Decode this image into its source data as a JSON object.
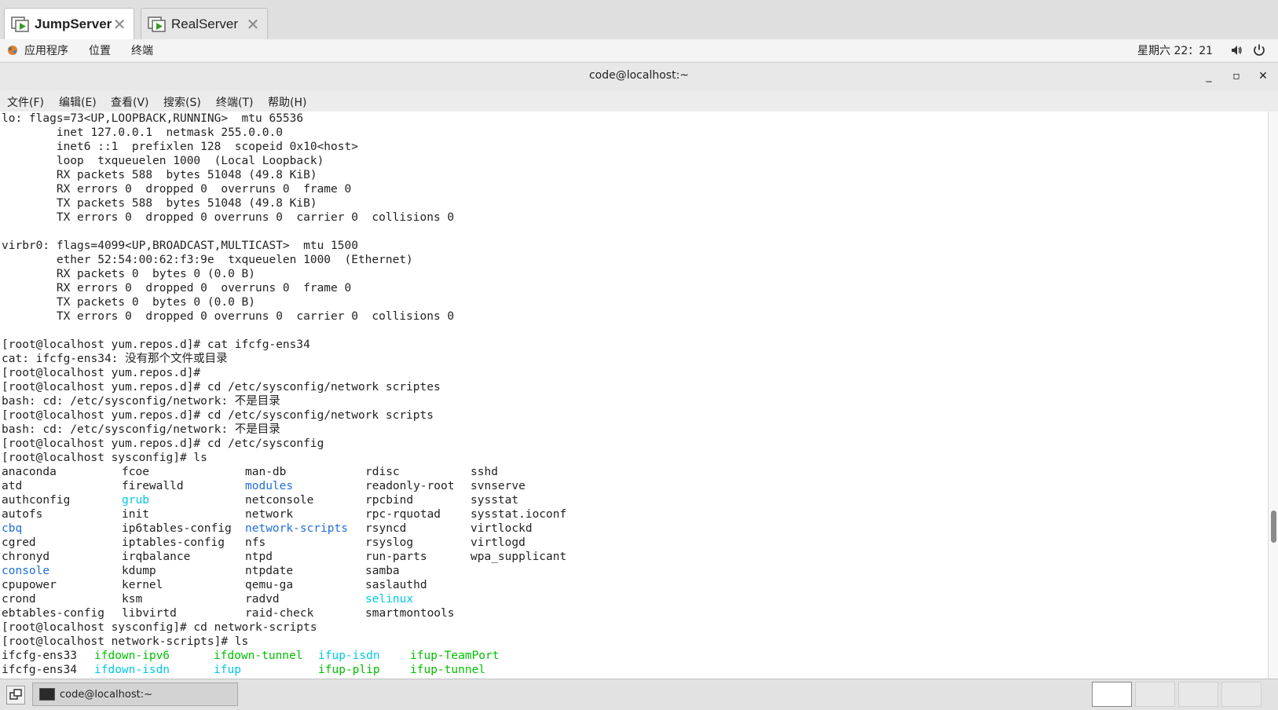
{
  "tabs": [
    {
      "label": "JumpServer",
      "active": true,
      "icon": "remote-screen-icon"
    },
    {
      "label": "RealServer",
      "active": false,
      "icon": "remote-screen-icon"
    }
  ],
  "gnome_bar": {
    "applications": "应用程序",
    "places": "位置",
    "terminal": "终端",
    "clock": "星期六 22：21",
    "volume_icon": "speaker-icon",
    "power_icon": "power-icon"
  },
  "window": {
    "title": "code@localhost:~",
    "minimize": "_",
    "maximize": "▫",
    "close": "✕"
  },
  "menu": [
    "文件(F)",
    "编辑(E)",
    "查看(V)",
    "搜索(S)",
    "终端(T)",
    "帮助(H)"
  ],
  "colors": {
    "terminal_bg": "#ffffff",
    "text": "#222222",
    "dir": "#1e6fd9",
    "link": "#00c8e6",
    "exec": "#00c000"
  },
  "terminal": {
    "lines": [
      [
        {
          "t": "lo: flags=73<UP,LOOPBACK,RUNNING>  mtu 65536"
        }
      ],
      [
        {
          "t": "        inet 127.0.0.1  netmask 255.0.0.0"
        }
      ],
      [
        {
          "t": "        inet6 ::1  prefixlen 128  scopeid 0x10<host>"
        }
      ],
      [
        {
          "t": "        loop  txqueuelen 1000  (Local Loopback)"
        }
      ],
      [
        {
          "t": "        RX packets 588  bytes 51048 (49.8 KiB)"
        }
      ],
      [
        {
          "t": "        RX errors 0  dropped 0  overruns 0  frame 0"
        }
      ],
      [
        {
          "t": "        TX packets 588  bytes 51048 (49.8 KiB)"
        }
      ],
      [
        {
          "t": "        TX errors 0  dropped 0 overruns 0  carrier 0  collisions 0"
        }
      ],
      [
        {
          "t": ""
        }
      ],
      [
        {
          "t": "virbr0: flags=4099<UP,BROADCAST,MULTICAST>  mtu 1500"
        }
      ],
      [
        {
          "t": "        ether 52:54:00:62:f3:9e  txqueuelen 1000  (Ethernet)"
        }
      ],
      [
        {
          "t": "        RX packets 0  bytes 0 (0.0 B)"
        }
      ],
      [
        {
          "t": "        RX errors 0  dropped 0  overruns 0  frame 0"
        }
      ],
      [
        {
          "t": "        TX packets 0  bytes 0 (0.0 B)"
        }
      ],
      [
        {
          "t": "        TX errors 0  dropped 0 overruns 0  carrier 0  collisions 0"
        }
      ],
      [
        {
          "t": ""
        }
      ],
      [
        {
          "t": "[root@localhost yum.repos.d]# cat ifcfg-ens34"
        }
      ],
      [
        {
          "t": "cat: ifcfg-ens34: 没有那个文件或目录"
        }
      ],
      [
        {
          "t": "[root@localhost yum.repos.d]#"
        }
      ],
      [
        {
          "t": "[root@localhost yum.repos.d]# cd /etc/sysconfig/network scriptes"
        }
      ],
      [
        {
          "t": "bash: cd: /etc/sysconfig/network: 不是目录"
        }
      ],
      [
        {
          "t": "[root@localhost yum.repos.d]# cd /etc/sysconfig/network scripts"
        }
      ],
      [
        {
          "t": "bash: cd: /etc/sysconfig/network: 不是目录"
        }
      ],
      [
        {
          "t": "[root@localhost yum.repos.d]# cd /etc/sysconfig"
        }
      ],
      [
        {
          "t": "[root@localhost sysconfig]# ls"
        }
      ],
      {
        "grid": [
          {
            "t": "anaconda"
          },
          {
            "t": "fcoe"
          },
          {
            "t": "man-db"
          },
          {
            "t": "rdisc"
          },
          {
            "t": "sshd"
          }
        ]
      },
      {
        "grid": [
          {
            "t": "atd"
          },
          {
            "t": "firewalld"
          },
          {
            "t": "modules",
            "c": "dir"
          },
          {
            "t": "readonly-root"
          },
          {
            "t": "svnserve"
          }
        ]
      },
      {
        "grid": [
          {
            "t": "authconfig"
          },
          {
            "t": "grub",
            "c": "link"
          },
          {
            "t": "netconsole"
          },
          {
            "t": "rpcbind"
          },
          {
            "t": "sysstat"
          }
        ]
      },
      {
        "grid": [
          {
            "t": "autofs"
          },
          {
            "t": "init"
          },
          {
            "t": "network"
          },
          {
            "t": "rpc-rquotad"
          },
          {
            "t": "sysstat.ioconf"
          }
        ]
      },
      {
        "grid": [
          {
            "t": "cbq",
            "c": "dir"
          },
          {
            "t": "ip6tables-config"
          },
          {
            "t": "network-scripts",
            "c": "dir"
          },
          {
            "t": "rsyncd"
          },
          {
            "t": "virtlockd"
          }
        ]
      },
      {
        "grid": [
          {
            "t": "cgred"
          },
          {
            "t": "iptables-config"
          },
          {
            "t": "nfs"
          },
          {
            "t": "rsyslog"
          },
          {
            "t": "virtlogd"
          }
        ]
      },
      {
        "grid": [
          {
            "t": "chronyd"
          },
          {
            "t": "irqbalance"
          },
          {
            "t": "ntpd"
          },
          {
            "t": "run-parts"
          },
          {
            "t": "wpa_supplicant"
          }
        ]
      },
      {
        "grid": [
          {
            "t": "console",
            "c": "dir"
          },
          {
            "t": "kdump"
          },
          {
            "t": "ntpdate"
          },
          {
            "t": "samba"
          },
          {
            "t": ""
          }
        ]
      },
      {
        "grid": [
          {
            "t": "cpupower"
          },
          {
            "t": "kernel"
          },
          {
            "t": "qemu-ga"
          },
          {
            "t": "saslauthd"
          },
          {
            "t": ""
          }
        ]
      },
      {
        "grid": [
          {
            "t": "crond"
          },
          {
            "t": "ksm"
          },
          {
            "t": "radvd"
          },
          {
            "t": "selinux",
            "c": "link"
          },
          {
            "t": ""
          }
        ]
      },
      {
        "grid": [
          {
            "t": "ebtables-config"
          },
          {
            "t": "libvirtd"
          },
          {
            "t": "raid-check"
          },
          {
            "t": "smartmontools"
          },
          {
            "t": ""
          }
        ]
      },
      [
        {
          "t": "[root@localhost sysconfig]# cd network-scripts"
        }
      ],
      [
        {
          "t": "[root@localhost network-scripts]# ls"
        }
      ],
      {
        "grid2": [
          {
            "t": "ifcfg-ens33"
          },
          {
            "t": "ifdown-ipv6",
            "c": "exec"
          },
          {
            "t": "ifdown-tunnel",
            "c": "exec"
          },
          {
            "t": "ifup-isdn",
            "c": "link"
          },
          {
            "t": "ifup-TeamPort",
            "c": "exec"
          }
        ]
      },
      {
        "grid2": [
          {
            "t": "ifcfg-ens34"
          },
          {
            "t": "ifdown-isdn",
            "c": "link"
          },
          {
            "t": "ifup",
            "c": "link"
          },
          {
            "t": "ifup-plip",
            "c": "exec"
          },
          {
            "t": "ifup-tunnel",
            "c": "exec"
          }
        ]
      }
    ]
  },
  "taskbar": {
    "task_label": "code@localhost:~",
    "workspaces": 4,
    "active_workspace": 1
  }
}
